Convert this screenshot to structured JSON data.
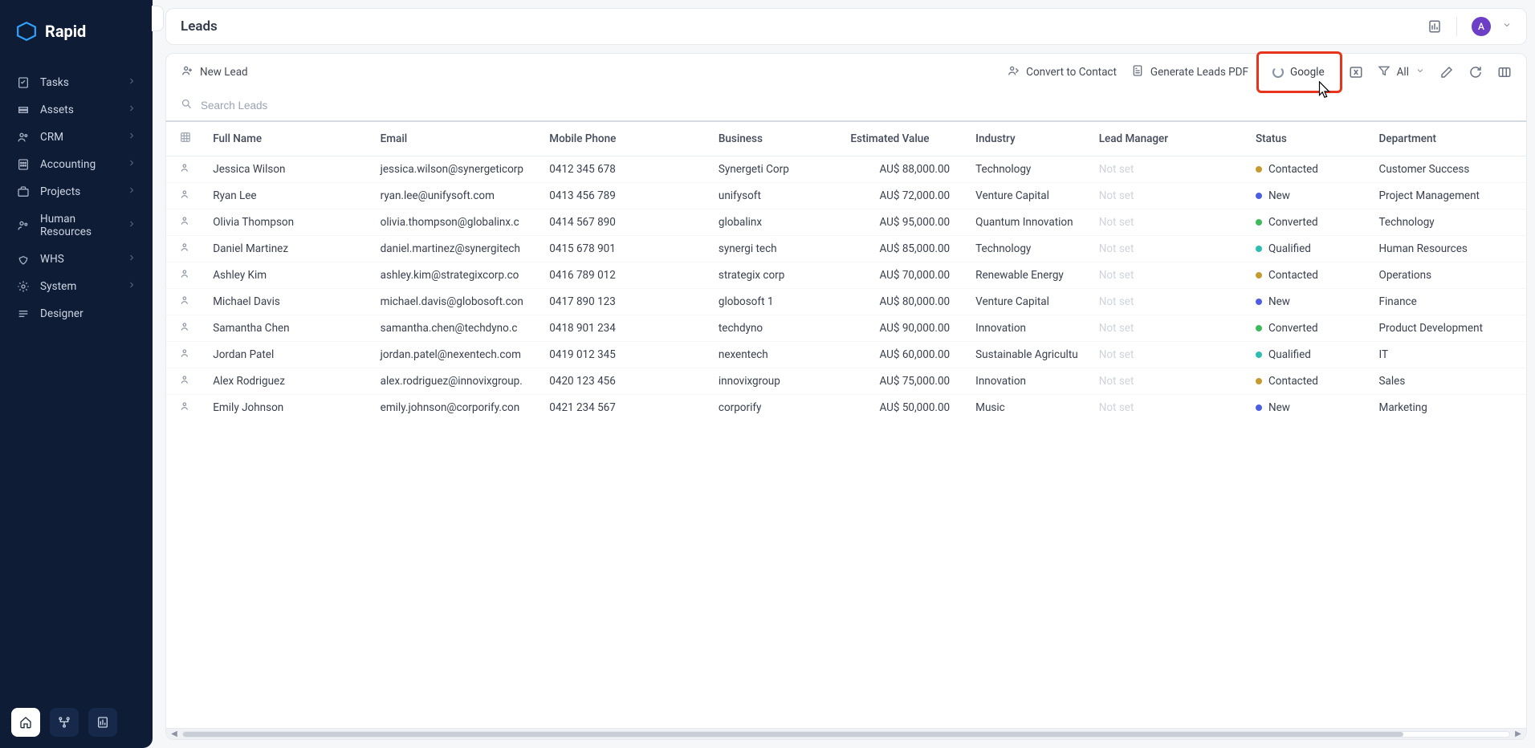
{
  "brand": {
    "name": "Rapid"
  },
  "sidebar": {
    "items": [
      {
        "label": "Tasks"
      },
      {
        "label": "Assets"
      },
      {
        "label": "CRM"
      },
      {
        "label": "Accounting"
      },
      {
        "label": "Projects"
      },
      {
        "label": "Human Resources"
      },
      {
        "label": "WHS"
      },
      {
        "label": "System"
      },
      {
        "label": "Designer"
      }
    ]
  },
  "header": {
    "title": "Leads",
    "avatar_initial": "A"
  },
  "toolbar": {
    "new_lead": "New Lead",
    "convert": "Convert to Contact",
    "generate_pdf": "Generate Leads PDF",
    "google": "Google",
    "filter_label": "All"
  },
  "search": {
    "placeholder": "Search Leads"
  },
  "columns": {
    "full_name": "Full Name",
    "email": "Email",
    "mobile": "Mobile Phone",
    "business": "Business",
    "value": "Estimated Value",
    "industry": "Industry",
    "lead_manager": "Lead Manager",
    "status": "Status",
    "department": "Department"
  },
  "not_set_label": "Not set",
  "rows": [
    {
      "name": "Jessica Wilson",
      "email": "jessica.wilson@synergeticorp",
      "phone": "0412 345 678",
      "business": "Synergeti Corp",
      "value": "AU$ 88,000.00",
      "industry": "Technology",
      "leadmgr": "",
      "status": "Contacted",
      "dept": "Customer Success"
    },
    {
      "name": "Ryan Lee",
      "email": "ryan.lee@unifysoft.com",
      "phone": "0413 456 789",
      "business": "unifysoft",
      "value": "AU$ 72,000.00",
      "industry": "Venture Capital",
      "leadmgr": "",
      "status": "New",
      "dept": "Project Management"
    },
    {
      "name": "Olivia Thompson",
      "email": "olivia.thompson@globalinx.c",
      "phone": "0414 567 890",
      "business": "globalinx",
      "value": "AU$ 95,000.00",
      "industry": "Quantum Innovation",
      "leadmgr": "",
      "status": "Converted",
      "dept": "Technology"
    },
    {
      "name": "Daniel Martinez",
      "email": "daniel.martinez@synergitech",
      "phone": "0415 678 901",
      "business": "synergi tech",
      "value": "AU$ 85,000.00",
      "industry": "Technology",
      "leadmgr": "",
      "status": "Qualified",
      "dept": "Human Resources"
    },
    {
      "name": "Ashley Kim",
      "email": "ashley.kim@strategixcorp.co",
      "phone": "0416 789 012",
      "business": "strategix corp",
      "value": "AU$ 70,000.00",
      "industry": "Renewable Energy",
      "leadmgr": "",
      "status": "Contacted",
      "dept": "Operations"
    },
    {
      "name": "Michael Davis",
      "email": "michael.davis@globosoft.con",
      "phone": "0417 890 123",
      "business": "globosoft 1",
      "value": "AU$ 80,000.00",
      "industry": "Venture Capital",
      "leadmgr": "",
      "status": "New",
      "dept": "Finance"
    },
    {
      "name": "Samantha Chen",
      "email": "samantha.chen@techdyno.c",
      "phone": "0418 901 234",
      "business": "techdyno",
      "value": "AU$ 90,000.00",
      "industry": "Innovation",
      "leadmgr": "",
      "status": "Converted",
      "dept": "Product Development"
    },
    {
      "name": "Jordan Patel",
      "email": "jordan.patel@nexentech.com",
      "phone": "0419 012 345",
      "business": "nexentech",
      "value": "AU$ 60,000.00",
      "industry": "Sustainable Agricultu",
      "leadmgr": "",
      "status": "Qualified",
      "dept": "IT"
    },
    {
      "name": "Alex Rodriguez",
      "email": "alex.rodriguez@innovixgroup.",
      "phone": "0420 123 456",
      "business": "innovixgroup",
      "value": "AU$ 75,000.00",
      "industry": "Innovation",
      "leadmgr": "",
      "status": "Contacted",
      "dept": "Sales"
    },
    {
      "name": "Emily Johnson",
      "email": "emily.johnson@corporify.con",
      "phone": "0421 234 567",
      "business": "corporify",
      "value": "AU$ 50,000.00",
      "industry": "Music",
      "leadmgr": "",
      "status": "New",
      "dept": "Marketing"
    }
  ],
  "status_colors": {
    "Contacted": "dot-contacted",
    "New": "dot-new",
    "Converted": "dot-converted",
    "Qualified": "dot-qualified"
  }
}
